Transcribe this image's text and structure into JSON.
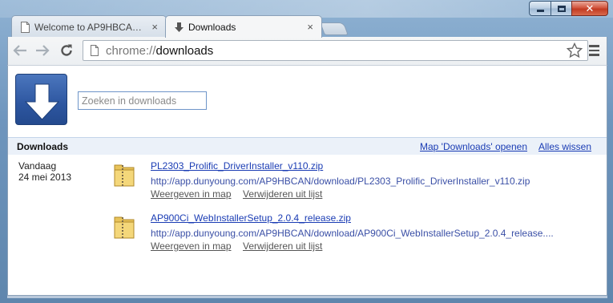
{
  "window": {
    "tabs": [
      {
        "label": "Welcome to AP9HBCAN - ...",
        "active": false
      },
      {
        "label": "Downloads",
        "active": true
      }
    ],
    "close_glyph": "×",
    "caption_close_glyph": "✕"
  },
  "toolbar": {
    "url_scheme": "chrome://",
    "url_path": "downloads",
    "icons": [
      "back-arrow-icon",
      "forward-arrow-icon",
      "reload-icon",
      "page-icon",
      "star-icon",
      "menu-icon"
    ]
  },
  "downloads_page": {
    "search_placeholder": "Zoeken in downloads",
    "section_title": "Downloads",
    "open_folder_link": "Map 'Downloads' openen",
    "clear_all_link": "Alles wissen",
    "date_label": "Vandaag",
    "date_value": "24 mei 2013",
    "items": [
      {
        "name": "PL2303_Prolific_DriverInstaller_v110.zip",
        "url": "http://app.dunyoung.com/AP9HBCAN/download/PL2303_Prolific_DriverInstaller_v110.zip",
        "show_in_folder": "Weergeven in map",
        "remove_from_list": "Verwijderen uit lijst"
      },
      {
        "name": "AP900Ci_WebInstallerSetup_2.0.4_release.zip",
        "url": "http://app.dunyoung.com/AP9HBCAN/download/AP900Ci_WebInstallerSetup_2.0.4_release....",
        "show_in_folder": "Weergeven in map",
        "remove_from_list": "Verwijderen uit lijst"
      }
    ]
  },
  "colors": {
    "link": "#1a3cb4",
    "header_bg": "#ebf1f9",
    "logo_blue": "#2d56a0"
  }
}
